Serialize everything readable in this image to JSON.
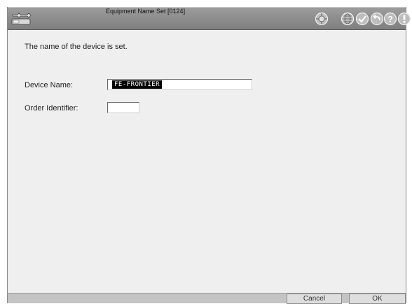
{
  "window": {
    "title": "Equipment Name Set [0124]"
  },
  "toolbar_icons": [
    "wrench-icon",
    "network-icon",
    "globe-icon",
    "checkmark-icon",
    "back-arrow-icon",
    "help-icon",
    "alert-icon"
  ],
  "main": {
    "instruction": "The name of the device is set.",
    "device_name_label": "Device Name:",
    "device_name_value": "FE-FRONTIER",
    "order_identifier_label": "Order Identifier:",
    "order_identifier_value": ""
  },
  "buttons": {
    "cancel": "Cancel",
    "ok": "OK"
  },
  "colors": {
    "titlebar": "#8e8e8e",
    "panel": "#efefef",
    "footer": "#c4c4c4",
    "selection": "#000000"
  }
}
